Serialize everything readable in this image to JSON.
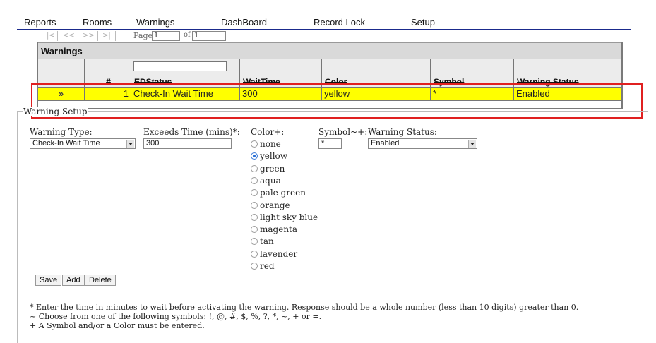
{
  "menu": [
    "Reports",
    "Rooms",
    "Warnings",
    "DashBoard",
    "Record Lock",
    "Setup"
  ],
  "pager": {
    "first": "|<",
    "prev": "<<",
    "next": ">>",
    "last": ">|",
    "page_label": "Page",
    "page_value": "1",
    "of_label": "of",
    "of_value": "1"
  },
  "grid": {
    "title": "Warnings",
    "filter_value": "",
    "columns": [
      "",
      "#",
      "EDStatus",
      "WaitTime",
      "Color",
      "Symbol",
      "Warning Status"
    ],
    "rows": [
      {
        "marker": "»",
        "num": "1",
        "edstatus": "Check-In Wait Time",
        "waittime": "300",
        "color": "yellow",
        "symbol": "*",
        "status": "Enabled"
      }
    ],
    "row_color": "#ffff00"
  },
  "setup": {
    "legend": "Warning Setup",
    "warning_type_label": "Warning Type:",
    "warning_type_value": "Check-In Wait Time",
    "exceeds_label": "Exceeds Time (mins)*:",
    "exceeds_value": "300",
    "color_label": "Color+:",
    "colors": [
      "none",
      "yellow",
      "green",
      "aqua",
      "pale green",
      "orange",
      "light sky blue",
      "magenta",
      "tan",
      "lavender",
      "red"
    ],
    "selected_color": "yellow",
    "symbol_label": "Symbol~+:",
    "symbol_value": "*",
    "status_label": "Warning Status:",
    "status_value": "Enabled"
  },
  "buttons": {
    "save": "Save",
    "add": "Add",
    "delete": "Delete"
  },
  "notes": [
    "* Enter the time in minutes to wait before activating the warning. Response should be a whole number (less than 10 digits) greater than 0.",
    "~ Choose from one of the following symbols: !, @, #, $, %, ?, *, ~, + or =.",
    "+ A Symbol and/or a Color must be entered."
  ],
  "accent_color": "#e02020"
}
